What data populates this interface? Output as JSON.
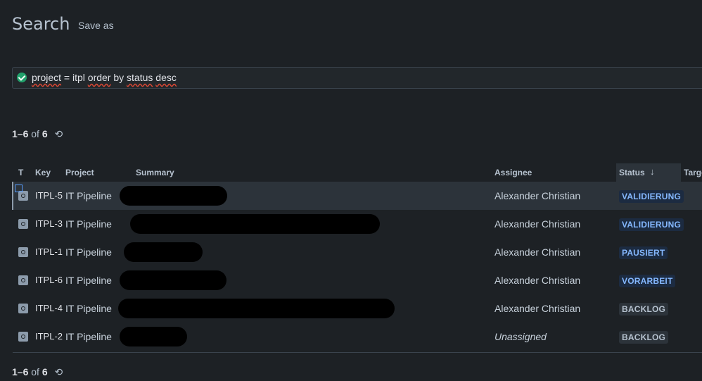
{
  "header": {
    "title": "Search",
    "save_as": "Save as"
  },
  "jql": {
    "query": "project = itpl order by status desc"
  },
  "pager": {
    "range": "1–6",
    "of": "of",
    "total": "6"
  },
  "table": {
    "columns": {
      "type": "T",
      "key": "Key",
      "project": "Project",
      "summary": "Summary",
      "assignee": "Assignee",
      "status": "Status",
      "target": "Targe"
    },
    "status_sort_icon": "arrow-down-icon",
    "rows": [
      {
        "key": "ITPL-5",
        "project": "IT Pipeline",
        "assignee": "Alexander Christian",
        "status": "VALIDIERUNG",
        "status_color": "blue"
      },
      {
        "key": "ITPL-3",
        "project": "IT Pipeline",
        "assignee": "Alexander Christian",
        "status": "VALIDIERUNG",
        "status_color": "blue"
      },
      {
        "key": "ITPL-1",
        "project": "IT Pipeline",
        "assignee": "Alexander Christian",
        "status": "PAUSIERT",
        "status_color": "blue"
      },
      {
        "key": "ITPL-6",
        "project": "IT Pipeline",
        "assignee": "Alexander Christian",
        "status": "VORARBEIT",
        "status_color": "blue"
      },
      {
        "key": "ITPL-4",
        "project": "IT Pipeline",
        "assignee": "Alexander Christian",
        "status": "BACKLOG",
        "status_color": "gray"
      },
      {
        "key": "ITPL-2",
        "project": "IT Pipeline",
        "assignee": "Unassigned",
        "status": "BACKLOG",
        "status_color": "gray"
      }
    ]
  },
  "colors": {
    "background": "#1d2125",
    "accent_blue": "#85b8ff",
    "success": "#22a06b"
  }
}
